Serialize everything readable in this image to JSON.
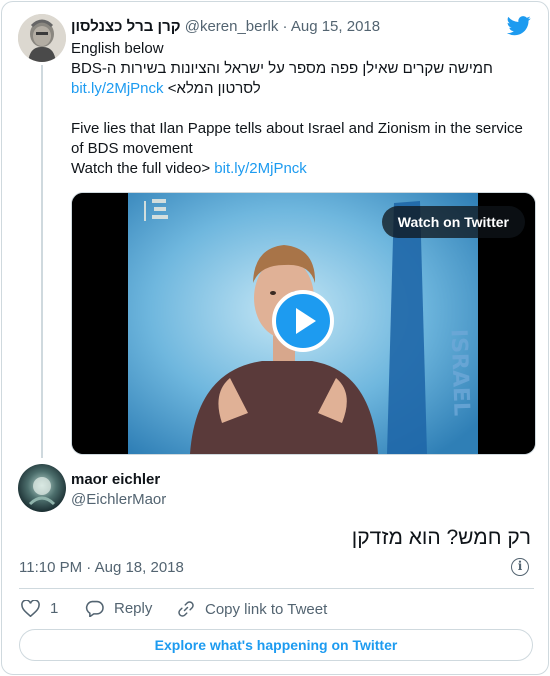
{
  "original_tweet": {
    "author_name": "קרן ברל כצנלסון",
    "handle": "@keren_berlk",
    "separator": "·",
    "date": "Aug 15, 2018",
    "lines": [
      "English below",
      "חמישה שקרים שאילן פפה מספר על ישראל והציונות בשירות ה-BDS",
      "לסרטון המלא>",
      "Five lies that Ilan Pappe tells about Israel and Zionism in the service of BDS movement",
      "Watch the full video>"
    ],
    "link": "bit.ly/2MjPnck",
    "video": {
      "watch_label": "Watch on Twitter",
      "sign_text": "ISRAEL"
    }
  },
  "reply_tweet": {
    "author_name": "maor eichler",
    "handle": "@EichlerMaor",
    "text": "רק חמש? הוא מזדקן",
    "time": "11:10 PM",
    "separator": "·",
    "date": "Aug 18, 2018",
    "info_icon": "i"
  },
  "actions": {
    "like_count": "1",
    "reply_label": "Reply",
    "copy_label": "Copy link to Tweet"
  },
  "footer": {
    "explore_label": "Explore what's happening on Twitter"
  },
  "colors": {
    "accent": "#1d9bf0",
    "text": "#0f1419",
    "muted": "#536471",
    "border": "#cfd9de"
  }
}
